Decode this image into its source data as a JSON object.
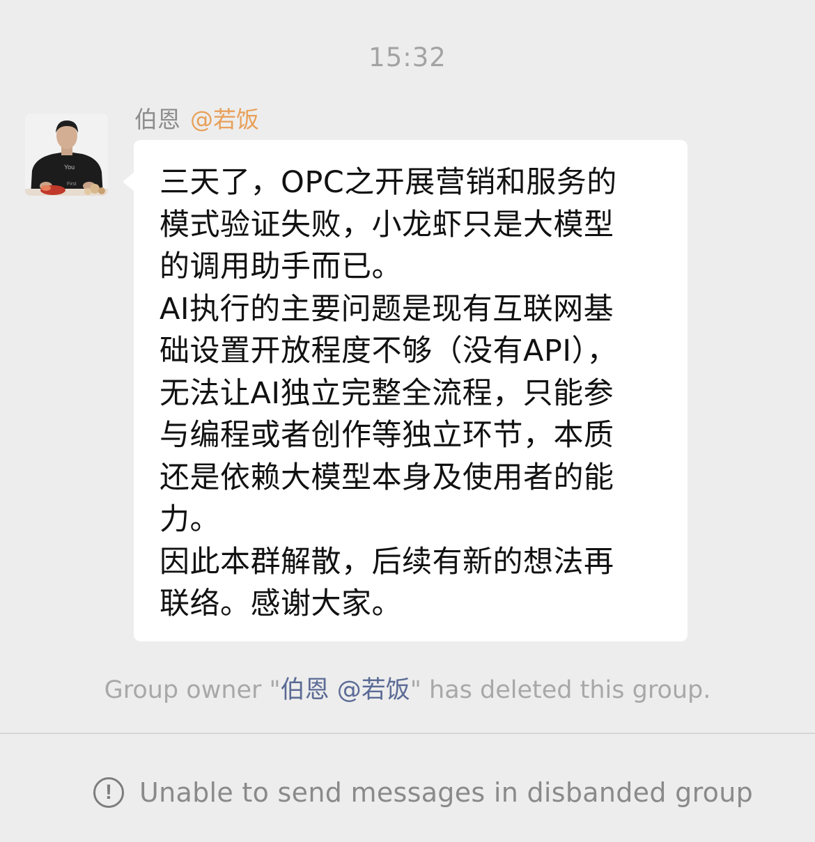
{
  "chat": {
    "timestamp": "15:32",
    "message": {
      "sender_name": "伯恩",
      "sender_mention": "@若饭",
      "lines": [
        "三天了，OPC之开展营销和服务的",
        "模式验证失败，小龙虾只是大模型",
        "的调用助手而已。",
        "AI执行的主要问题是现有互联网基",
        "础设置开放程度不够（没有API），",
        "无法让AI独立完整全流程，只能参",
        "与编程或者创作等独立环节，本质",
        "还是依赖大模型本身及使用者的能",
        "力。",
        "因此本群解散，后续有新的想法再",
        "联络。感谢大家。"
      ]
    },
    "system_notice": {
      "prefix": "Group owner \"",
      "name": "伯恩 @若饭",
      "suffix": "\" has deleted this group."
    }
  },
  "footer": {
    "icon": "alert-circle-icon",
    "text": "Unable to send messages in disbanded group"
  },
  "colors": {
    "background": "#ededed",
    "bubble": "#ffffff",
    "mention": "#e8a05a",
    "system_name": "#5b6b95"
  }
}
